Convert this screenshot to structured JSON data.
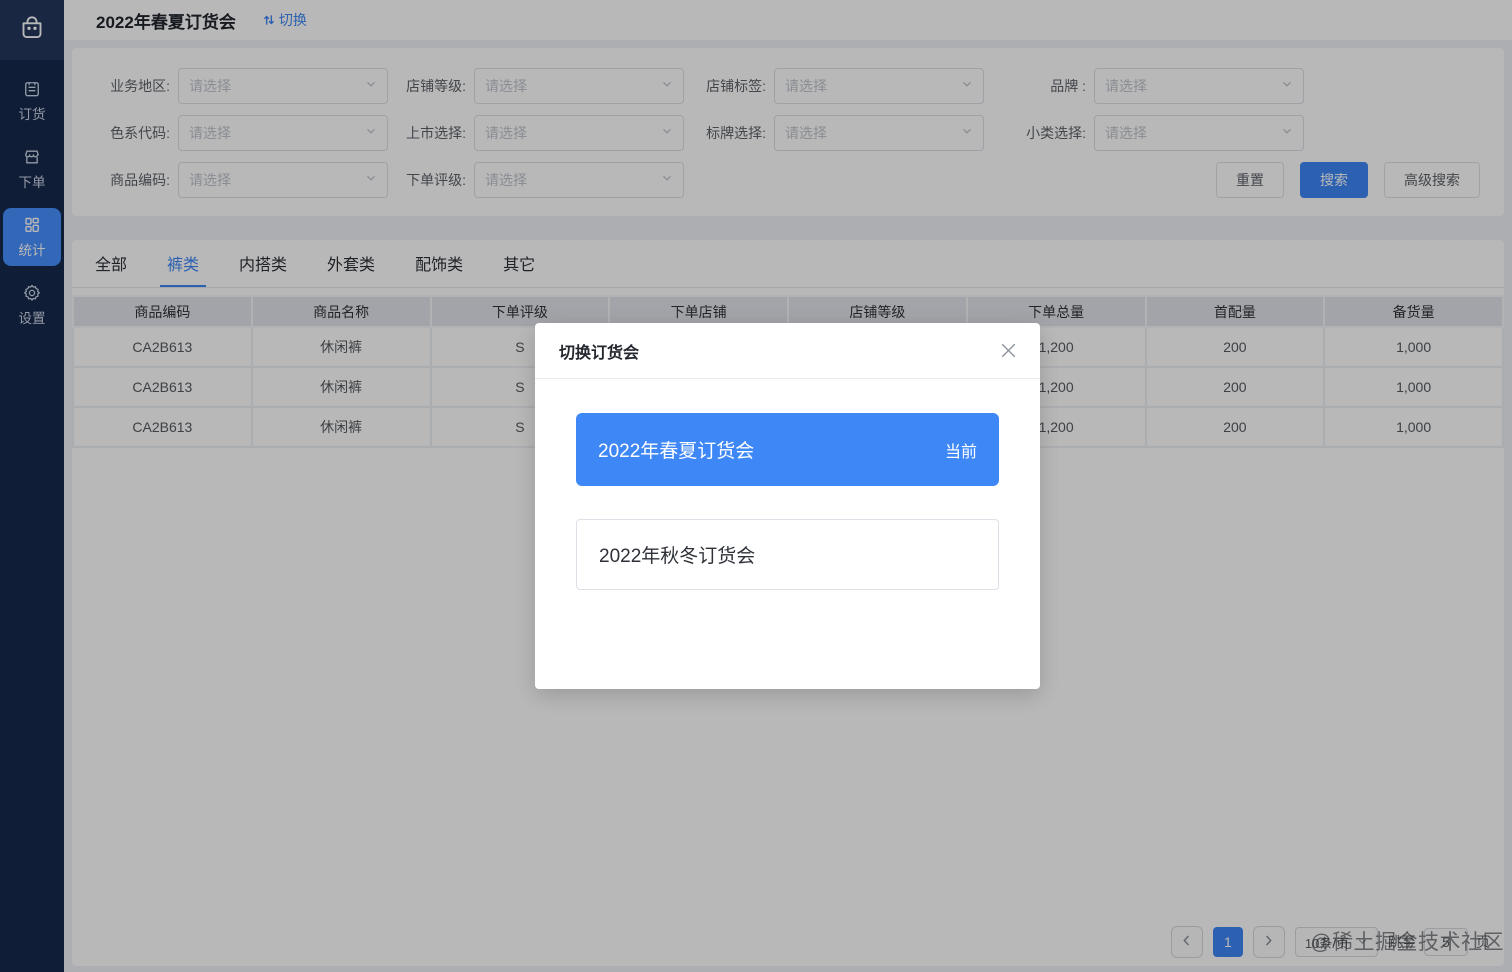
{
  "theme": {
    "primary": "#3e87f6",
    "sidebar_bg": "#15294d",
    "sidebar_logo_bg": "#23365c"
  },
  "sidebar": {
    "logo_icon": "shopping-bag-icon",
    "items": [
      {
        "icon": "order-book-icon",
        "label": "订货",
        "active": false
      },
      {
        "icon": "storefront-icon",
        "label": "下单",
        "active": false
      },
      {
        "icon": "grid-stats-icon",
        "label": "统计",
        "active": true
      },
      {
        "icon": "gear-icon",
        "label": "设置",
        "active": false
      }
    ]
  },
  "header": {
    "title": "2022年春夏订货会",
    "switch_icon": "sort-arrows-icon",
    "switch_label": "切换"
  },
  "filters": {
    "placeholder": "请选择",
    "fields": [
      {
        "label": "业务地区:"
      },
      {
        "label": "店铺等级:"
      },
      {
        "label": "店铺标签:"
      },
      {
        "label": "品牌 :"
      },
      {
        "label": "色系代码:"
      },
      {
        "label": "上市选择:"
      },
      {
        "label": "标牌选择:"
      },
      {
        "label": "小类选择:"
      },
      {
        "label": "商品编码:"
      },
      {
        "label": "下单评级:"
      }
    ],
    "buttons": {
      "reset": "重置",
      "search": "搜索",
      "advanced": "高级搜索"
    }
  },
  "tabs": [
    {
      "label": "全部",
      "active": false
    },
    {
      "label": "裤类",
      "active": true
    },
    {
      "label": "内搭类",
      "active": false
    },
    {
      "label": "外套类",
      "active": false
    },
    {
      "label": "配饰类",
      "active": false
    },
    {
      "label": "其它",
      "active": false
    }
  ],
  "table": {
    "columns": [
      "商品编码",
      "商品名称",
      "下单评级",
      "下单店铺",
      "店铺等级",
      "下单总量",
      "首配量",
      "备货量"
    ],
    "rows": [
      [
        "CA2B613",
        "休闲裤",
        "S",
        "",
        "",
        "1,200",
        "200",
        "1,000"
      ],
      [
        "CA2B613",
        "休闲裤",
        "S",
        "",
        "",
        "1,200",
        "200",
        "1,000"
      ],
      [
        "CA2B613",
        "休闲裤",
        "S",
        "",
        "",
        "1,200",
        "200",
        "1,000"
      ]
    ]
  },
  "pagination": {
    "current_page": "1",
    "page_size": "10条/页",
    "jump_before": "跳至",
    "jump_value": "5",
    "jump_after": "页"
  },
  "modal": {
    "title": "切换订货会",
    "options": [
      {
        "label": "2022年春夏订货会",
        "badge": "当前",
        "current": true
      },
      {
        "label": "2022年秋冬订货会",
        "badge": "",
        "current": false
      }
    ]
  },
  "watermark": "@稀土掘金技术社区"
}
